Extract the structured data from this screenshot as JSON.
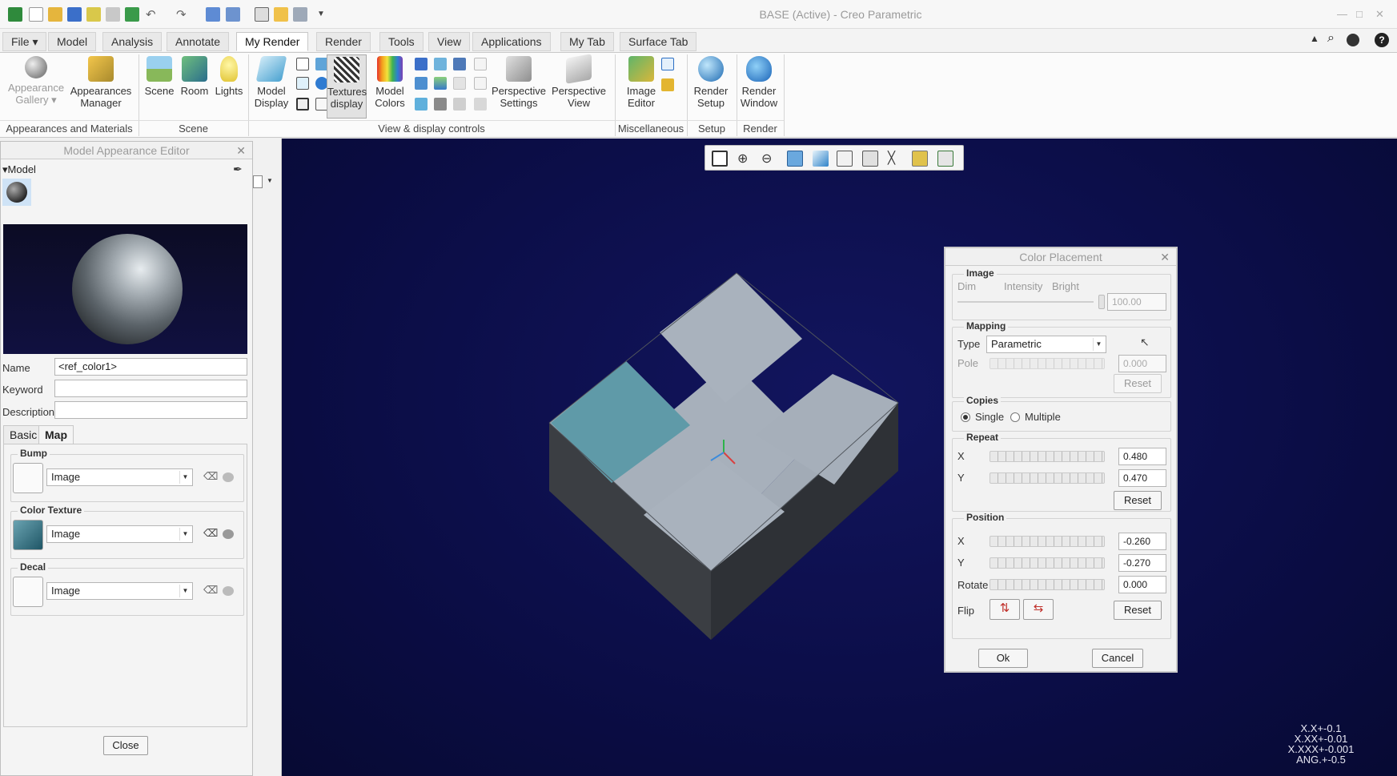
{
  "window": {
    "title": "BASE (Active) - Creo Parametric"
  },
  "menu": {
    "tabs": [
      "File",
      "Model",
      "Analysis",
      "Annotate",
      "My Render",
      "Render",
      "Tools",
      "View",
      "Applications",
      "My Tab",
      "Surface Tab"
    ],
    "active": "My Render"
  },
  "ribbon": {
    "buttons": {
      "appearance_gallery": [
        "Appearance",
        "Gallery"
      ],
      "appearances_manager": [
        "Appearances",
        "Manager"
      ],
      "scene": "Scene",
      "room": "Room",
      "lights": "Lights",
      "model_display": [
        "Model",
        "Display"
      ],
      "textures_display": [
        "Textures",
        "display"
      ],
      "model_colors": [
        "Model",
        "Colors"
      ],
      "perspective_settings": [
        "Perspective",
        "Settings"
      ],
      "perspective_view": [
        "Perspective",
        "View"
      ],
      "image_editor": [
        "Image",
        "Editor"
      ],
      "render_setup": [
        "Render",
        "Setup"
      ],
      "render_window": [
        "Render",
        "Window"
      ]
    },
    "groups": {
      "appearances": "Appearances and Materials",
      "scene": "Scene",
      "view_display": "View & display controls",
      "misc": "Miscellaneous",
      "setup": "Setup",
      "render": "Render"
    }
  },
  "appearance_editor": {
    "title": "Model Appearance Editor",
    "section": "Model",
    "name_label": "Name",
    "name_value": "<ref_color1>",
    "keyword_label": "Keyword",
    "keyword_value": "",
    "description_label": "Description",
    "description_value": "",
    "tabs": [
      "Basic",
      "Map"
    ],
    "active_tab": "Map",
    "bump": {
      "label": "Bump",
      "type": "Image"
    },
    "color_texture": {
      "label": "Color Texture",
      "type": "Image"
    },
    "decal": {
      "label": "Decal",
      "type": "Image"
    },
    "close_label": "Close"
  },
  "color_placement": {
    "title": "Color Placement",
    "image": {
      "label": "Image",
      "dim": "Dim",
      "intensity": "Intensity",
      "bright": "Bright",
      "value": "100.00"
    },
    "mapping": {
      "label": "Mapping",
      "type_label": "Type",
      "type_value": "Parametric",
      "pole_label": "Pole",
      "pole_value": "0.000",
      "reset": "Reset"
    },
    "copies": {
      "label": "Copies",
      "single": "Single",
      "multiple": "Multiple",
      "selected": "Single"
    },
    "repeat": {
      "label": "Repeat",
      "x_label": "X",
      "x_value": "0.480",
      "y_label": "Y",
      "y_value": "0.470",
      "reset": "Reset"
    },
    "position": {
      "label": "Position",
      "x_label": "X",
      "x_value": "-0.260",
      "y_label": "Y",
      "y_value": "-0.270",
      "rotate_label": "Rotate",
      "rotate_value": "0.000",
      "flip_label": "Flip",
      "reset": "Reset"
    },
    "ok": "Ok",
    "cancel": "Cancel"
  },
  "tolerances": [
    "X.X+-0.1",
    "X.XX+-0.01",
    "X.XXX+-0.001",
    "ANG.+-0.5"
  ],
  "colors": {
    "viewport_bg": "#0b0d46",
    "model_face": "#a7b0bb",
    "model_side": "#3a3d42",
    "texture_patch": "#5f9aa8"
  }
}
